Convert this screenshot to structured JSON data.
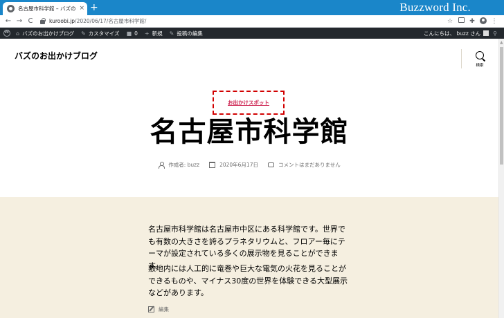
{
  "browser": {
    "tab_title": "名古屋市科学館 – バズのお出かけブ",
    "tab_close": "×",
    "new_tab": "+",
    "brand": "Buzzword Inc.",
    "url_host": "kuroobi.jp",
    "url_path": "/2020/06/17/名古屋市科学館/",
    "nav": {
      "back": "←",
      "forward": "→",
      "reload": "C"
    },
    "icons": [
      "star-icon",
      "extension-icon",
      "puzzle-icon",
      "profile-icon",
      "menu-icon"
    ]
  },
  "adminbar": {
    "site_name": "バズのお出かけブログ",
    "customize": "カスタマイズ",
    "comments_count": "0",
    "new": "新規",
    "edit_post": "投稿の編集",
    "greeting": "こんにちは、 buzz さん",
    "colors": {
      "bg": "#23282d"
    }
  },
  "header": {
    "site_title": "バズのお出かけブログ",
    "search_label": "検索"
  },
  "post": {
    "category": "お出かけスポット",
    "title": "名古屋市科学館",
    "author": "作成者: buzz",
    "date": "2020年6月17日",
    "comments": "コメントはまだありません",
    "paragraphs": [
      "名古屋市科学館は名古屋市中区にある科学館です。世界でも有数の大きさを誇るプラネタリウムと、フロアー毎にテーマが設定されている多くの展示物を見ることができます。",
      "敷地内には人工的に竜巻や巨大な電気の火花を見ることができるものや、マイナス30度の世界を体験できる大型展示などがあります。"
    ],
    "edit_label": "編集"
  },
  "colors": {
    "accent": "#cd2653",
    "content_bg": "#f5efe0",
    "highlight_border": "#d10000",
    "tabstrip": "#1a86c9"
  }
}
